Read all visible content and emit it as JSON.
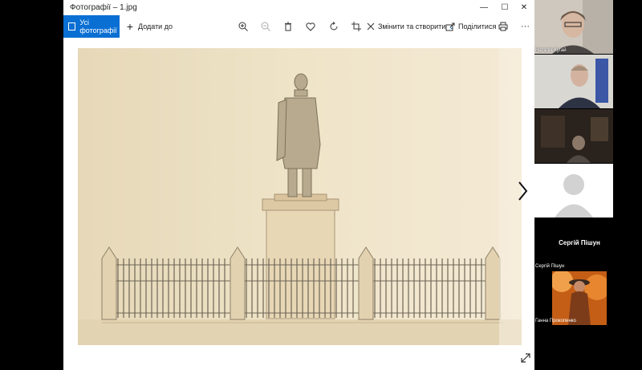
{
  "window": {
    "title": "Фотографії – 1.jpg",
    "minimize": "—",
    "maximize": "☐",
    "close": "✕"
  },
  "toolbar": {
    "all_photos": "Усі фотографії",
    "add_to": "Додати до",
    "edit_create": "Змінити та створити",
    "share": "Поділитися",
    "more": "···"
  },
  "participants": [
    {
      "name": "Наталія Кугай"
    },
    {
      "name": ""
    },
    {
      "name": ""
    },
    {
      "name": "Сергій Пішун",
      "center_label": "Сергій Пішун"
    },
    {
      "name": "Ганна Прокопенко"
    }
  ],
  "colors": {
    "accent": "#0a6fd3",
    "paper": "#ece0c4"
  }
}
